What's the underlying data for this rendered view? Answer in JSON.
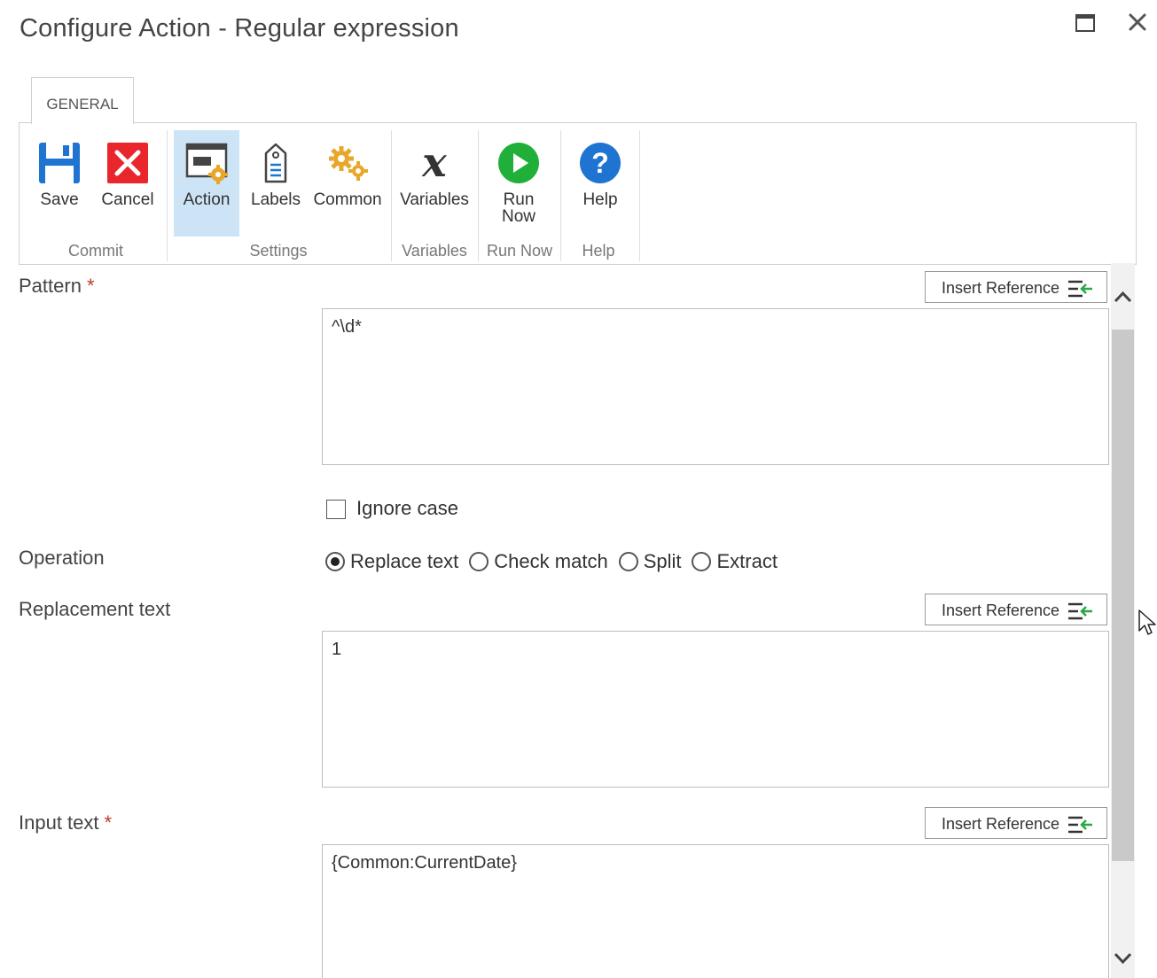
{
  "window": {
    "title": "Configure Action - Regular expression"
  },
  "ribbon": {
    "tab": "GENERAL",
    "buttons": {
      "save": "Save",
      "cancel": "Cancel",
      "action": "Action",
      "labels": "Labels",
      "common": "Common",
      "variables": "Variables",
      "run_now_line1": "Run",
      "run_now_line2": "Now",
      "help": "Help"
    },
    "groups": {
      "commit": "Commit",
      "settings": "Settings",
      "variables": "Variables",
      "run_now": "Run Now",
      "help": "Help"
    },
    "active_button": "Action",
    "icons": [
      "save-icon",
      "cancel-icon",
      "action-icon",
      "labels-icon",
      "common-icon",
      "variables-icon",
      "run-now-icon",
      "help-icon"
    ]
  },
  "form": {
    "pattern": {
      "label": "Pattern",
      "required_marker": "*",
      "value": "^\\d*",
      "insert_reference": "Insert Reference"
    },
    "ignore_case": {
      "label": "Ignore case",
      "checked": false
    },
    "operation": {
      "label": "Operation",
      "options": [
        "Replace text",
        "Check match",
        "Split",
        "Extract"
      ],
      "selected": "Replace text"
    },
    "replacement": {
      "label": "Replacement text",
      "value": "1",
      "insert_reference": "Insert Reference"
    },
    "input": {
      "label": "Input text",
      "required_marker": "*",
      "value": "{Common:CurrentDate}",
      "insert_reference": "Insert Reference"
    }
  },
  "colors": {
    "accent_blue": "#1f73d1",
    "cancel_red": "#e8262b",
    "run_green": "#20b03a",
    "required_red": "#c0392b",
    "active_highlight": "#cde4f7",
    "insert_ref_green": "#2aa843"
  }
}
